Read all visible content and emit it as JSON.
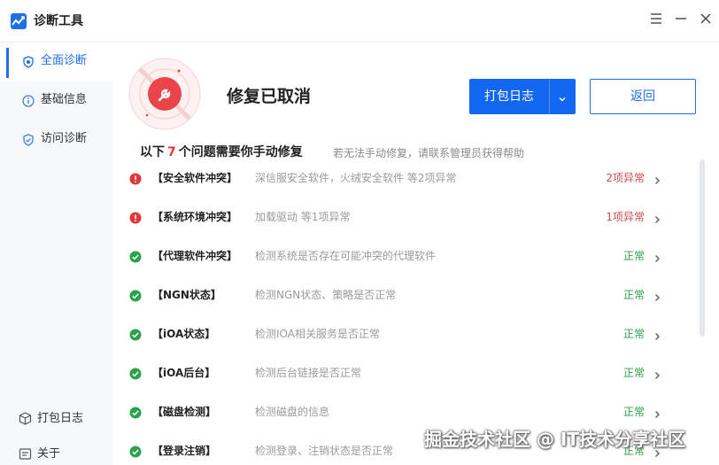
{
  "window": {
    "title": "诊断工具",
    "colors": {
      "accent": "#1367f0",
      "error": "#e0383a",
      "ok": "#2aa24a"
    }
  },
  "sidebar": {
    "items": [
      {
        "label": "全面诊断",
        "icon": "shield-scan-icon",
        "active": true
      },
      {
        "label": "基础信息",
        "icon": "info-shield-icon",
        "active": false
      },
      {
        "label": "访问诊断",
        "icon": "access-shield-icon",
        "active": false
      }
    ],
    "bottom": [
      {
        "label": "打包日志",
        "icon": "package-icon"
      },
      {
        "label": "关于",
        "icon": "about-icon"
      }
    ]
  },
  "header": {
    "status_title": "修复已取消",
    "pack_button": "打包日志",
    "back_button": "返回"
  },
  "summary": {
    "prefix": "以下",
    "count": "7",
    "suffix": "个问题需要你手动修复",
    "hint": "若无法手动修复，请联系管理员获得帮助"
  },
  "items": [
    {
      "name": "【安全软件冲突】",
      "desc": "深信服安全软件，火绒安全软件 等2项异常",
      "status": "2项异常",
      "state": "error"
    },
    {
      "name": "【系统环境冲突】",
      "desc": "加载驱动 等1项异常",
      "status": "1项异常",
      "state": "error"
    },
    {
      "name": "【代理软件冲突】",
      "desc": "检测系统是否存在可能冲突的代理软件",
      "status": "正常",
      "state": "ok"
    },
    {
      "name": "【NGN状态】",
      "desc": "检测NGN状态、策略是否正常",
      "status": "正常",
      "state": "ok"
    },
    {
      "name": "【iOA状态】",
      "desc": "检测IOA相关服务是否正常",
      "status": "正常",
      "state": "ok"
    },
    {
      "name": "【iOA后台】",
      "desc": "检测后台链接是否正常",
      "status": "正常",
      "state": "ok"
    },
    {
      "name": "【磁盘检测】",
      "desc": "检测磁盘的信息",
      "status": "正常",
      "state": "ok"
    },
    {
      "name": "【登录注销】",
      "desc": "检测登录、注销状态是否正常",
      "status": "正常",
      "state": "ok"
    }
  ],
  "watermark": "掘金技术社区 @ IT技术分享社区"
}
